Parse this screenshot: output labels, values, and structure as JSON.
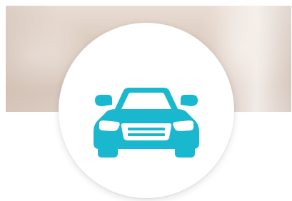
{
  "hero": {
    "background": "blurred-beige-photo"
  },
  "feature_icon": {
    "icon": "car-icon",
    "color": "#1ab8cf",
    "circle_color": "#ffffff"
  }
}
